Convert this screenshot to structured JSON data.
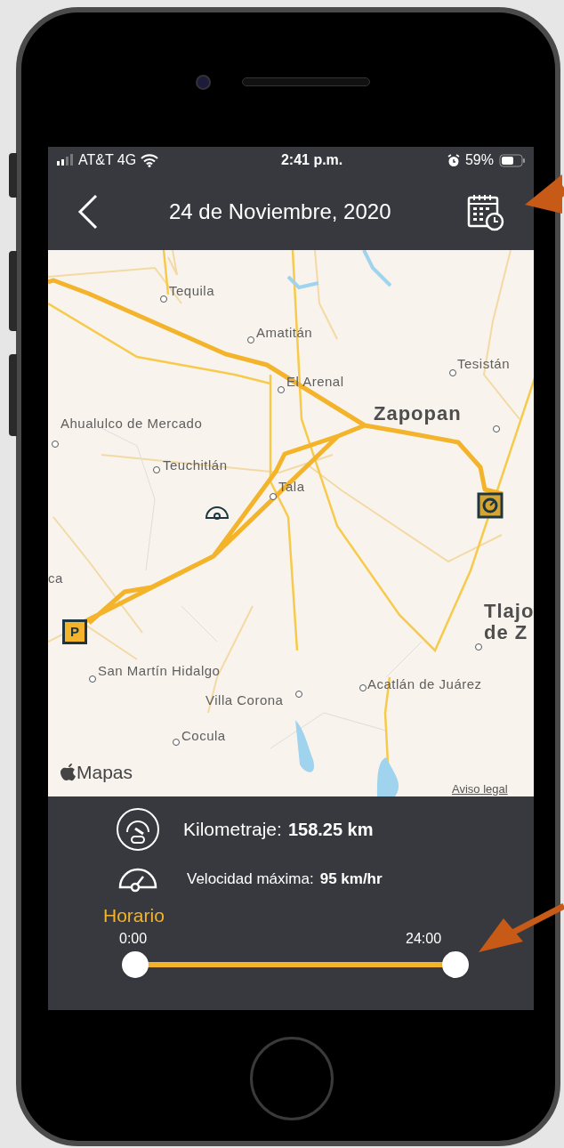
{
  "status_bar": {
    "carrier": "AT&T 4G",
    "time": "2:41 p.m.",
    "battery": "59%"
  },
  "header": {
    "title": "24 de Noviembre, 2020"
  },
  "map": {
    "labels": [
      {
        "text": "Tequila",
        "kind": "town"
      },
      {
        "text": "Amatitán",
        "kind": "town"
      },
      {
        "text": "El Arenal",
        "kind": "town"
      },
      {
        "text": "Tesistán",
        "kind": "town"
      },
      {
        "text": "Ahualulco de Mercado",
        "kind": "town"
      },
      {
        "text": "Zapopan",
        "kind": "city"
      },
      {
        "text": "Teuchitlán",
        "kind": "town"
      },
      {
        "text": "Tala",
        "kind": "town"
      },
      {
        "text": "ca",
        "kind": "town"
      },
      {
        "text": "Tlajo de Z",
        "kind": "city"
      },
      {
        "text": "San Martín Hidalgo",
        "kind": "town"
      },
      {
        "text": "Villa Corona",
        "kind": "town"
      },
      {
        "text": "Acatlán de Juárez",
        "kind": "town"
      },
      {
        "text": "Cocula",
        "kind": "town"
      }
    ],
    "parking_marker": "P",
    "attribution": "Mapas",
    "legal": "Aviso legal"
  },
  "stats": [
    {
      "kind": "odometer",
      "label": "Kilometraje:",
      "value": "158.25 km"
    },
    {
      "kind": "speed",
      "label": "Velocidad máxima:",
      "value": "95 km/hr"
    }
  ],
  "schedule": {
    "title": "Horario",
    "start_label": "0:00",
    "end_label": "24:00",
    "start": {
      "level": 0
    },
    "end": {
      "level": 1
    }
  }
}
